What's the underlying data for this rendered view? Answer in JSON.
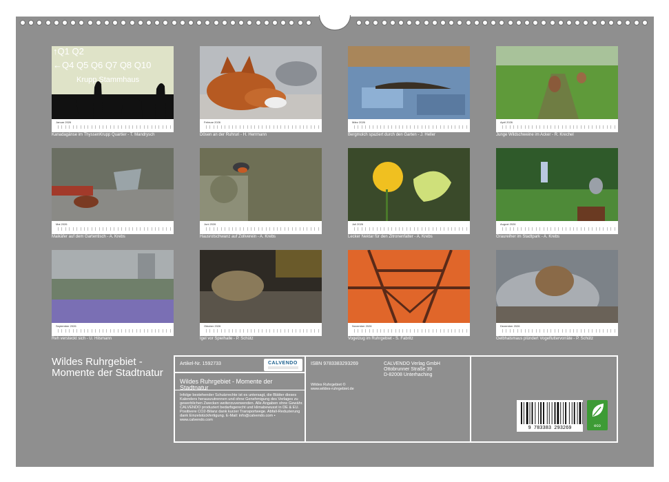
{
  "months": [
    {
      "name": "Januar 2026",
      "caption": "Kanadagänse im ThyssenKrupp Quartier - T. Mandrysch",
      "sign_lines": [
        "↑Q1  Q2",
        "←Q4 Q5 Q6 Q7 Q8 Q10",
        "Krupp Stammhaus"
      ]
    },
    {
      "name": "Februar 2026",
      "caption": "Dösen an der Ruhruri - H. Herrmann"
    },
    {
      "name": "März 2026",
      "caption": "Bergmolch spaziert durch den Garten - J. Heller"
    },
    {
      "name": "April 2026",
      "caption": "Junge Wildschweine im Acker - R. Krechel"
    },
    {
      "name": "Mai 2026",
      "caption": "Maikäfer auf dem Gartentisch - A. Krebs"
    },
    {
      "name": "Juni 2026",
      "caption": "Hausrotschwanz auf Zollverein - A. Krebs"
    },
    {
      "name": "Juli 2026",
      "caption": "Lecker Nektar für den Zitronenfalter - A. Krebs"
    },
    {
      "name": "August 2026",
      "caption": "Graureiher im Stadtpark - A. Krebs"
    },
    {
      "name": "September 2026",
      "caption": "Reh versteckt sich - U. Hilsmann"
    },
    {
      "name": "Oktober 2026",
      "caption": "Igel vor Spielhalle - P. Schütz"
    },
    {
      "name": "November 2026",
      "caption": "Vogelzug im Ruhrgebiet - S. Fabritz"
    },
    {
      "name": "Dezember 2026",
      "caption": "Gelbhalsmaus plündert Vogelfuttervorräte - P. Schütz"
    }
  ],
  "title": "Wildes Ruhrgebiet - Momente der Stadtnatur",
  "info": {
    "artikel": "Artikel-Nr. 1592733",
    "logo": "CALVENDO",
    "title_repeat": "Wildes Ruhrgebiet - Momente der Stadtnatur",
    "legal": "Infolge bestehender Schutzrechte ist es untersagt, die Blätter dieses Kalenders herauszutrennen und ohne Genehmigung des Verlages zu gewerblichen Zwecken weiterzuverwenden. Alle Angaben ohne Gewähr. CALVENDO produziert bedarfsgerecht und klimabewusst in DE & EU. Positivere CO2-Bilanz dank kurzer Transportwege. Abfall-Reduzierung dank Einzelstückfertigung. E-Mail: info@calvendo.com • www.calvendo.com",
    "isbn": "ISBN 9783383293269",
    "credit_line1": "Wildes Ruhrgebiet ©",
    "credit_line2": "www.wildes-ruhrgebiet.de",
    "publisher_line1": "CALVENDO Verlag GmbH",
    "publisher_line2": "Ottobrunner Straße 39",
    "publisher_line3": "D-82008 Unterhaching",
    "barcode_digits": "9 783383 293269",
    "eco_label": "eco"
  }
}
